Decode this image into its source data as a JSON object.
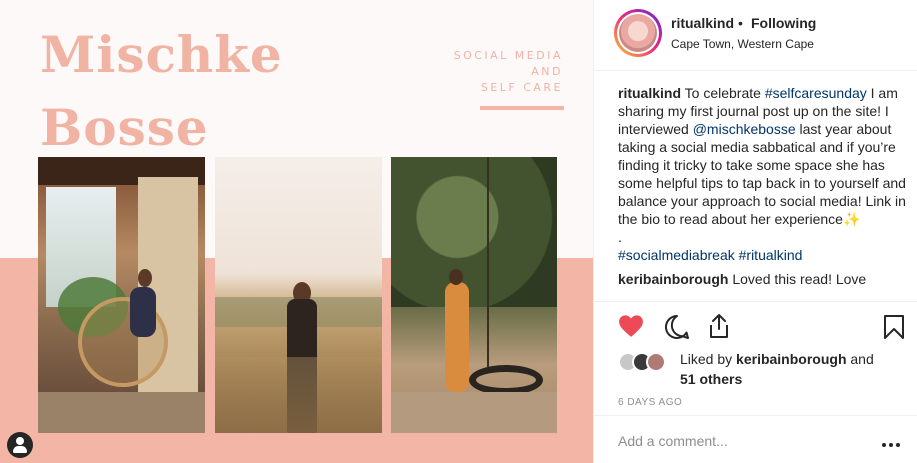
{
  "post_image": {
    "title_line1": "Mischke",
    "title_line2": "Bosse",
    "tagline_line1": "SOCIAL MEDIA",
    "tagline_line2": "AND",
    "tagline_line3": "SELF CARE"
  },
  "header": {
    "username": "ritualkind",
    "separator": "•",
    "follow_status": "Following",
    "location": "Cape Town, Western Cape"
  },
  "caption": {
    "author": "ritualkind",
    "text_1": " To celebrate ",
    "hashtag_1": "#selfcaresunday",
    "text_2": " I am sharing my first journal post up on the site! I interviewed ",
    "mention": "@mischkebosse",
    "text_3": " last year about taking a social media sabbatical and if you’re finding it tricky to take some space she has some helpful tips to tap back in to yourself and balance your approach to social media! Link in the bio to read about her experience",
    "sparkle": "✨",
    "dot_line": ".",
    "hashtag_2": "#socialmediabreak",
    "hashtag_space": " ",
    "hashtag_3": "#ritualkind"
  },
  "comment_preview": {
    "author": "keribainborough",
    "text": " Loved this read! Love"
  },
  "likes": {
    "prefix": "Liked by ",
    "user": "keribainborough",
    "middle": " and",
    "others": "51 others"
  },
  "timestamp": "6 DAYS AGO",
  "comment_bar": {
    "placeholder": "Add a comment..."
  },
  "colors": {
    "accent_peach": "#f3b6a6",
    "like_red": "#ed4956",
    "link_blue": "#003569"
  }
}
